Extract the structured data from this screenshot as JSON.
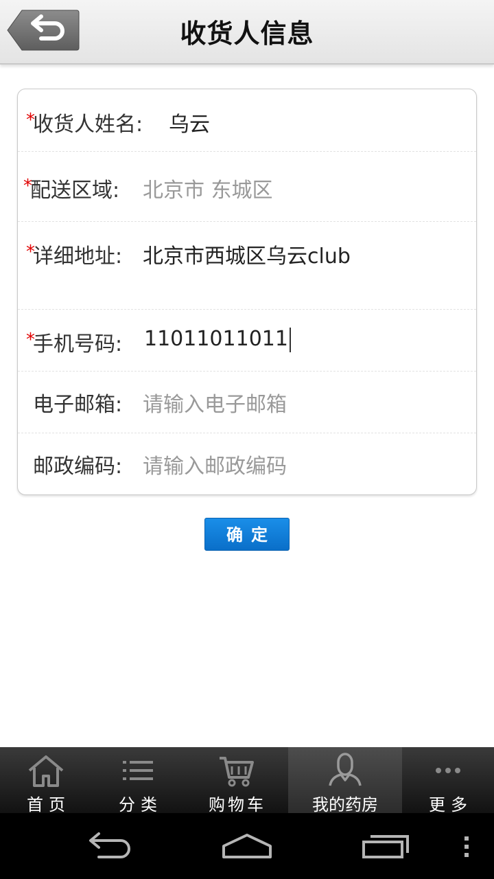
{
  "header": {
    "title": "收货人信息",
    "back_icon": "back-arrow-icon"
  },
  "form": {
    "fields": [
      {
        "label": "收货人姓名:",
        "required": true,
        "value": "乌云",
        "value_style": "filled"
      },
      {
        "label": "配送区域:",
        "required": true,
        "value": "北京市 东城区",
        "value_style": "selected"
      },
      {
        "label": "详细地址:",
        "required": true,
        "value": "北京市西城区乌云club",
        "value_style": "filled"
      },
      {
        "label": "手机号码:",
        "required": true,
        "value": "11011011011",
        "value_style": "filled"
      },
      {
        "label": "电子邮箱:",
        "required": false,
        "placeholder": "请输入电子邮箱"
      },
      {
        "label": "邮政编码:",
        "required": false,
        "placeholder": "请输入邮政编码"
      }
    ],
    "required_mark": "*"
  },
  "confirm_button": {
    "label": "确定"
  },
  "tabbar": {
    "tabs": [
      {
        "label": "首页",
        "icon": "home-icon",
        "active": false
      },
      {
        "label": "分类",
        "icon": "list-icon",
        "active": false
      },
      {
        "label": "购物车",
        "icon": "cart-icon",
        "active": false
      },
      {
        "label": "我的药房",
        "icon": "user-icon",
        "active": true
      },
      {
        "label": "更多",
        "icon": "more-icon",
        "active": false
      }
    ]
  },
  "system_nav": {
    "back": "back-icon",
    "home": "home-icon",
    "recents": "recents-icon",
    "menu": "menu-icon"
  },
  "colors": {
    "required": "#e00000",
    "button": "#0a78d4",
    "tabbar": "#1e1e1e"
  }
}
